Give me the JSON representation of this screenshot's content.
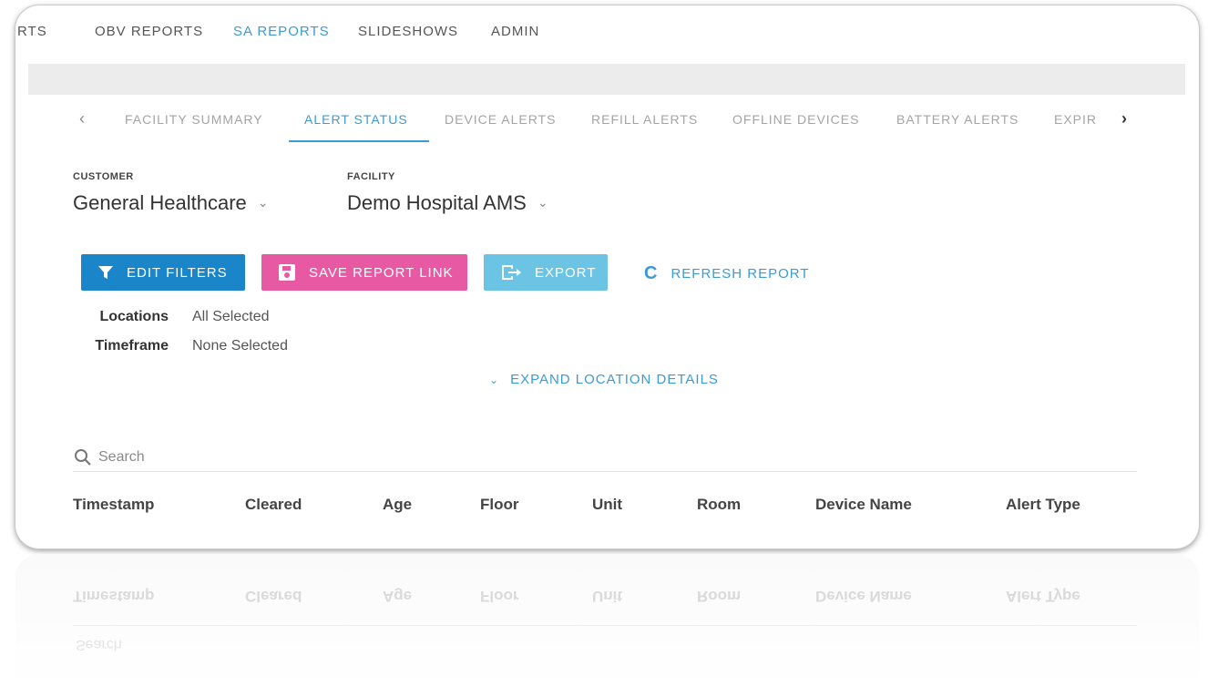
{
  "topnav": {
    "items": [
      {
        "label": "RTS",
        "active": false
      },
      {
        "label": "OBV REPORTS",
        "active": false
      },
      {
        "label": "SA REPORTS",
        "active": true
      },
      {
        "label": "SLIDESHOWS",
        "active": false
      },
      {
        "label": "ADMIN",
        "active": false
      }
    ]
  },
  "tabs": {
    "items": [
      {
        "label": "FACILITY SUMMARY",
        "active": false
      },
      {
        "label": "ALERT STATUS",
        "active": true
      },
      {
        "label": "DEVICE ALERTS",
        "active": false
      },
      {
        "label": "REFILL ALERTS",
        "active": false
      },
      {
        "label": "OFFLINE DEVICES",
        "active": false
      },
      {
        "label": "BATTERY ALERTS",
        "active": false
      },
      {
        "label": "EXPIR",
        "active": false
      }
    ],
    "prev_icon": "‹",
    "next_icon": "›"
  },
  "selectors": {
    "customer": {
      "label": "CUSTOMER",
      "value": "General Healthcare"
    },
    "facility": {
      "label": "FACILITY",
      "value": "Demo Hospital AMS"
    },
    "chevron": "⌄"
  },
  "actions": {
    "edit_filters": "EDIT FILTERS",
    "save_report_link": "SAVE REPORT LINK",
    "export": "EXPORT",
    "refresh_report": "REFRESH REPORT",
    "refresh_icon": "C"
  },
  "filters": {
    "locations_label": "Locations",
    "locations_value": "All Selected",
    "timeframe_label": "Timeframe",
    "timeframe_value": "None Selected",
    "expand_label": "EXPAND LOCATION DETAILS",
    "expand_icon": "⌄"
  },
  "search": {
    "placeholder": "Search"
  },
  "table": {
    "headers": [
      "Timestamp",
      "Cleared",
      "Age",
      "Floor",
      "Unit",
      "Room",
      "Device Name",
      "Alert Type"
    ]
  },
  "colors": {
    "accent": "#3c9ad6",
    "edit_filters_bg": "#1a85c8",
    "save_link_bg": "#e75aa3",
    "export_bg": "#6cc4e4"
  }
}
